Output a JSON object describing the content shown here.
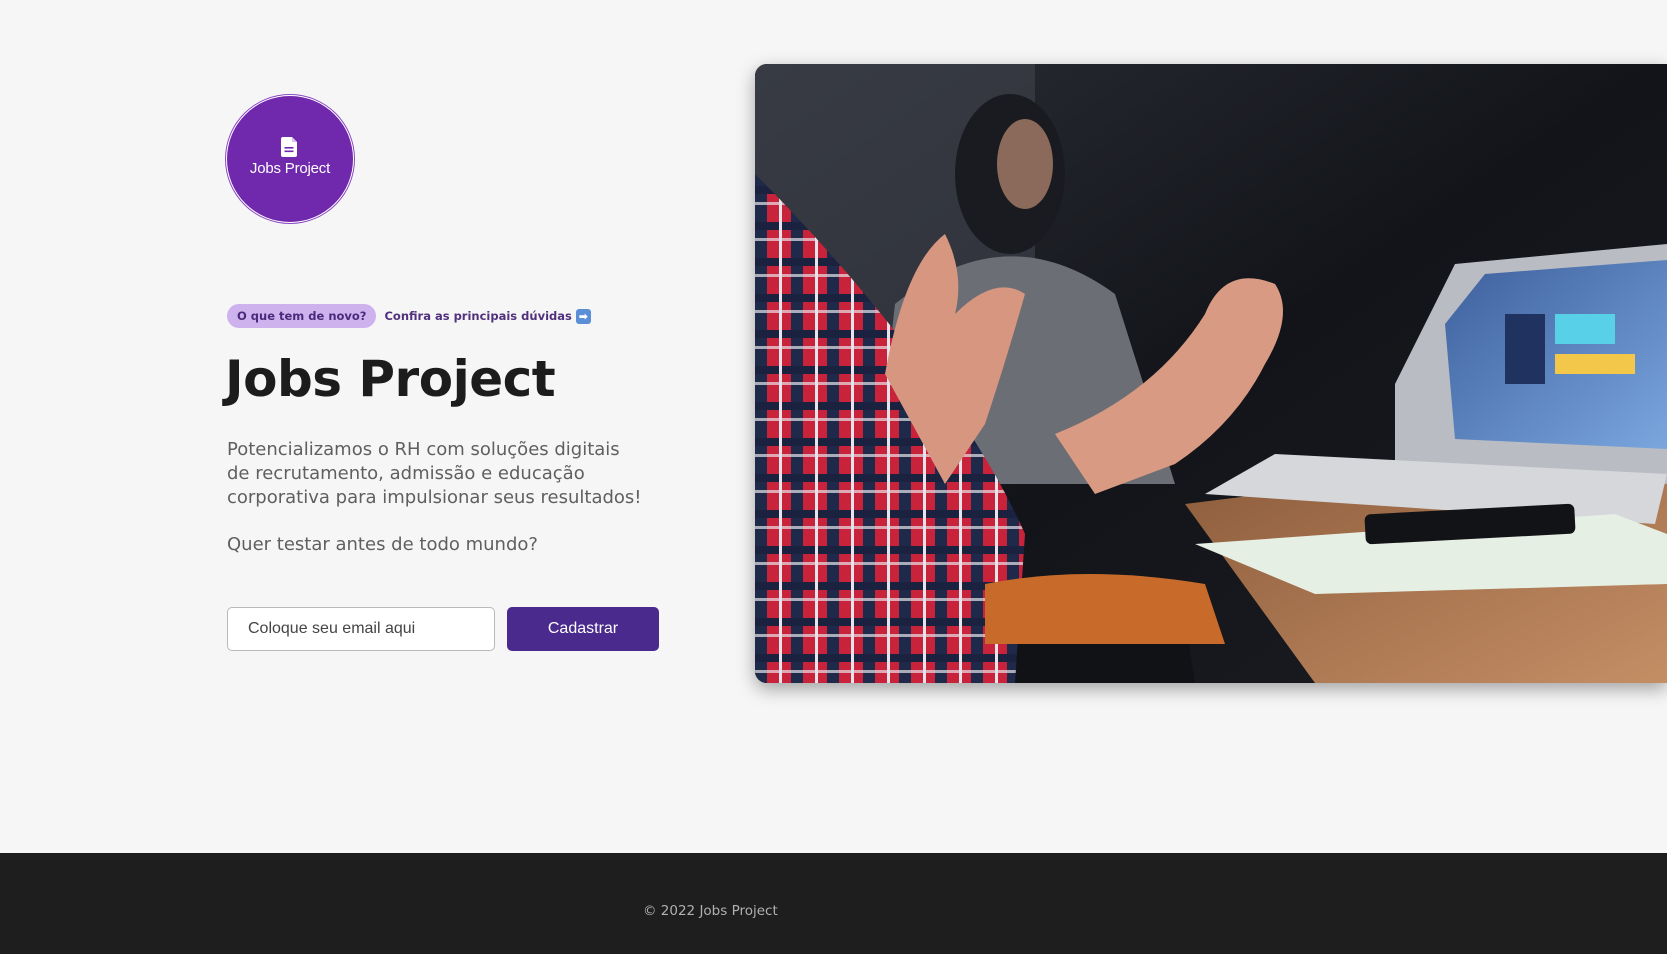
{
  "logo": {
    "label": "Jobs Project",
    "icon": "document-icon",
    "bg_color": "#7028ad"
  },
  "announcement": {
    "badge": "O que tem de novo?",
    "link": "Confira as principais dúvidas",
    "link_icon": "right-arrow-icon",
    "arrow_glyph": "➡"
  },
  "hero": {
    "title": "Jobs Project",
    "description": "Potencializamos o RH com soluções digitais de recrutamento, admissão e educação corporativa para impulsionar seus resultados!",
    "question": "Quer testar antes de todo mundo?"
  },
  "signup": {
    "email_placeholder": "Coloque seu email aqui",
    "email_value": "",
    "submit_label": "Cadastrar",
    "accent_color": "#4a2a8c"
  },
  "footer": {
    "copyright": "© 2022 Jobs Project"
  }
}
